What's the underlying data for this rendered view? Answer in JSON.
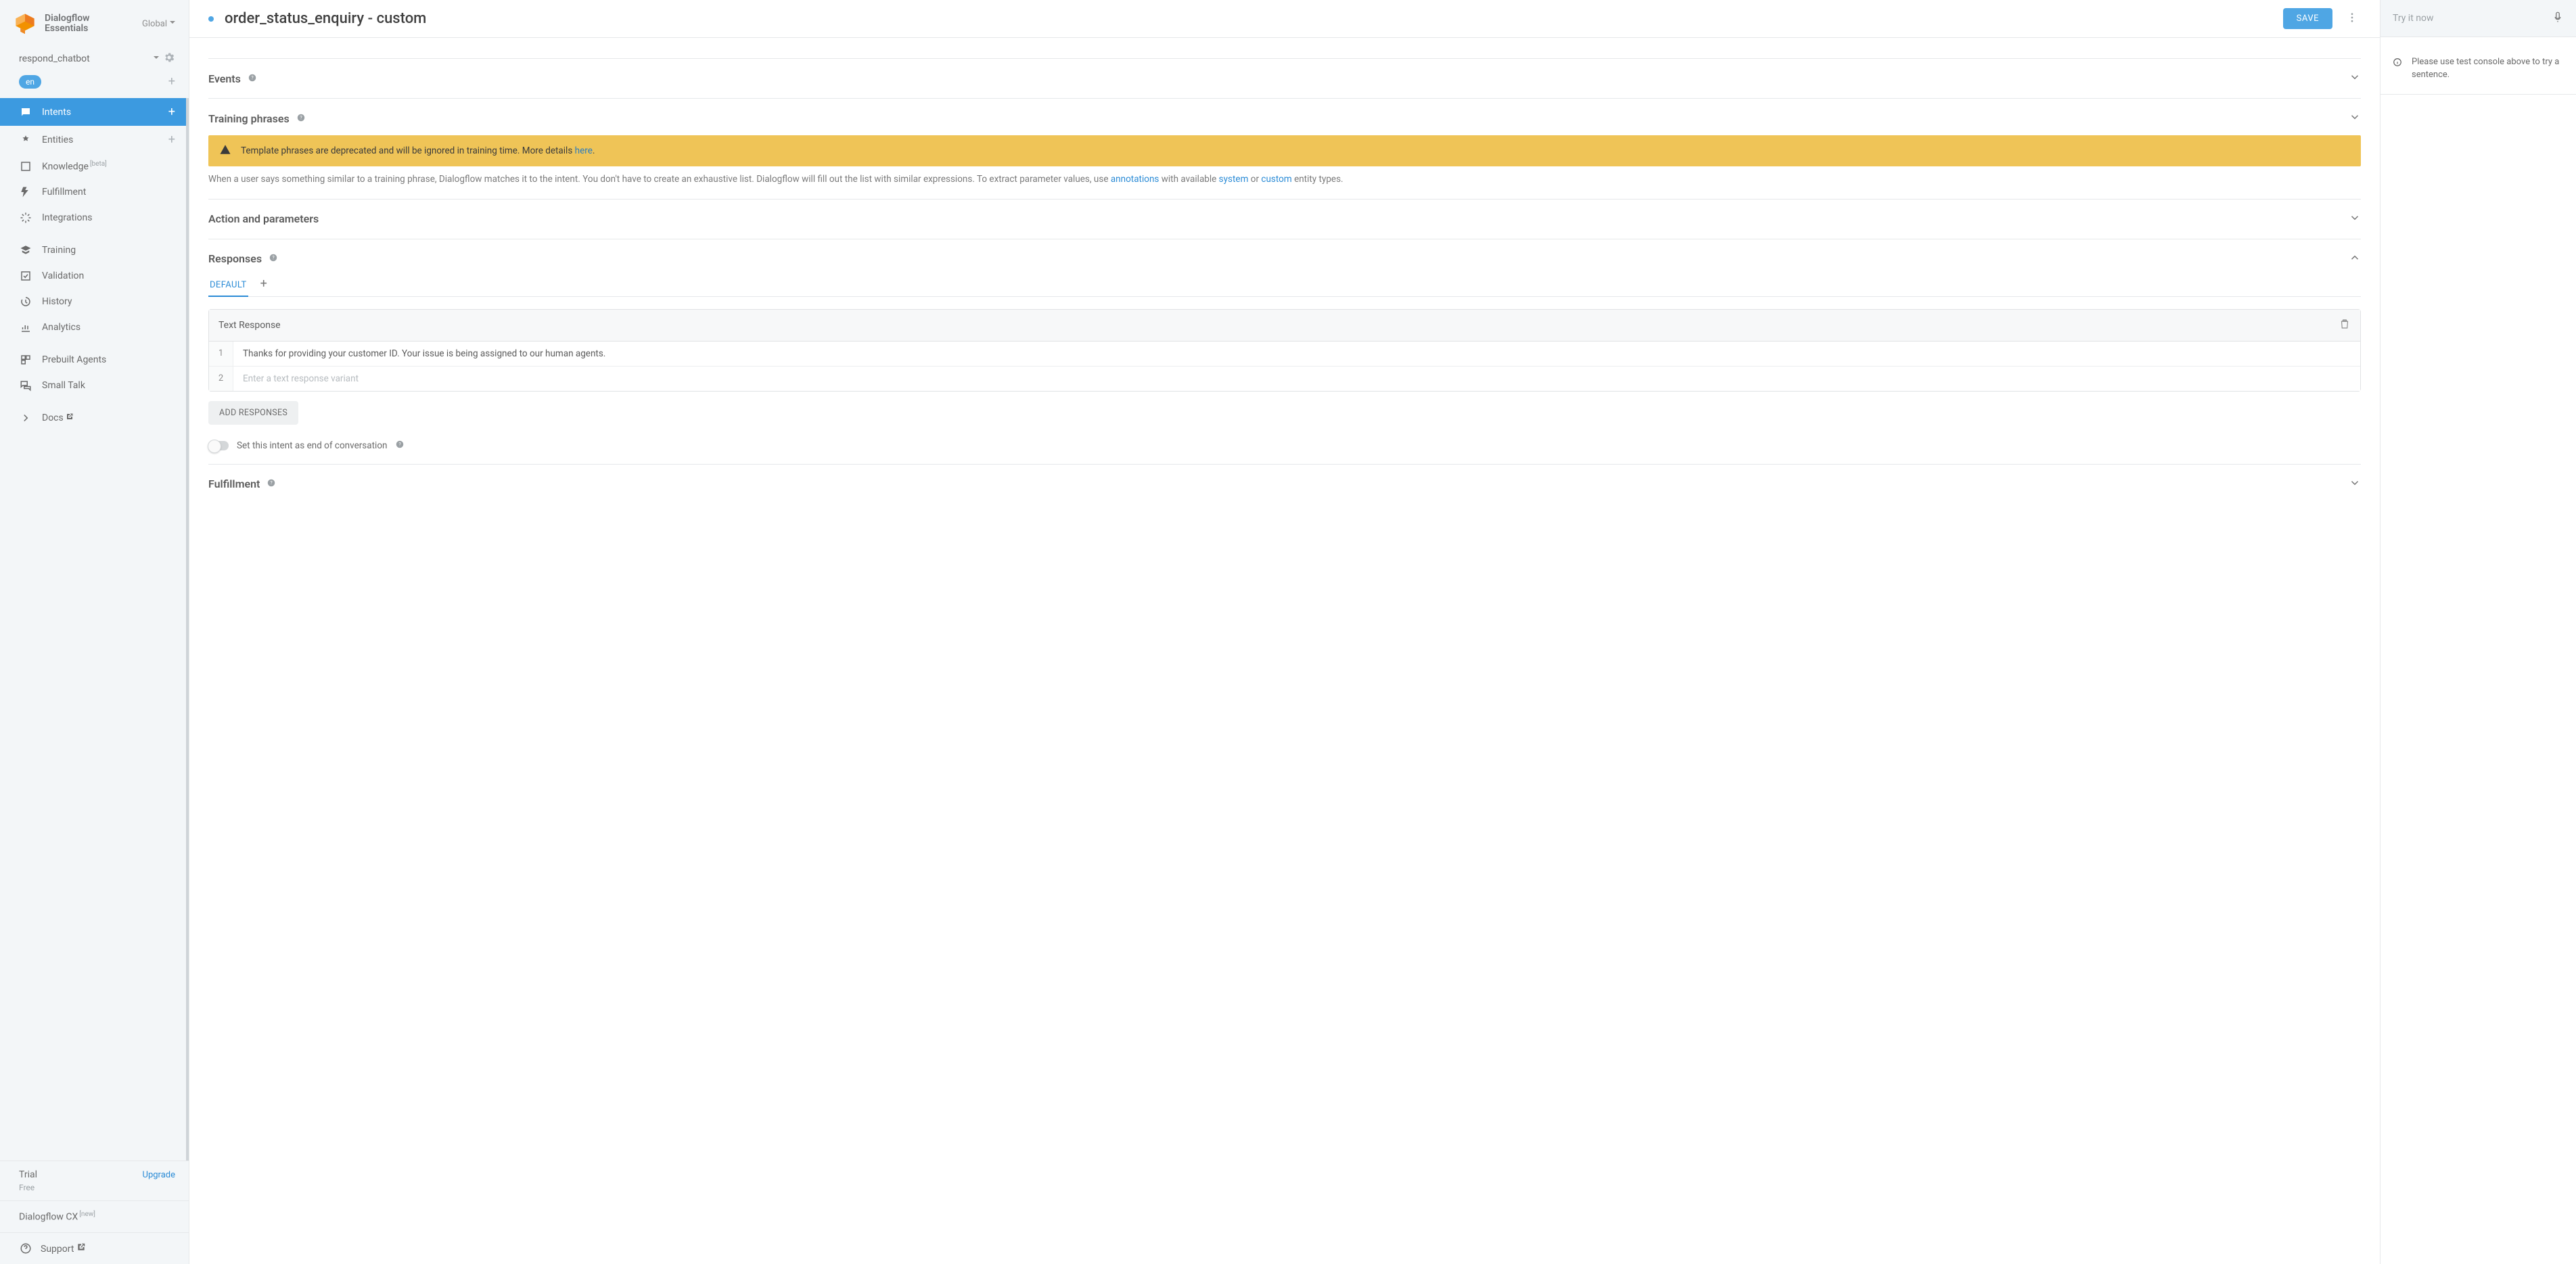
{
  "brand": {
    "name1": "Dialogflow",
    "name2": "Essentials",
    "region": "Global"
  },
  "agent": {
    "name": "respond_chatbot",
    "lang": "en"
  },
  "nav": {
    "intents": "Intents",
    "entities": "Entities",
    "knowledge": "Knowledge",
    "knowledge_sup": "[beta]",
    "fulfillment": "Fulfillment",
    "integrations": "Integrations",
    "training": "Training",
    "validation": "Validation",
    "history": "History",
    "analytics": "Analytics",
    "prebuilt": "Prebuilt Agents",
    "smalltalk": "Small Talk",
    "docs": "Docs"
  },
  "sidebar_footer": {
    "tier_title": "Trial",
    "tier_sub": "Free",
    "upgrade": "Upgrade",
    "cx_label": "Dialogflow CX",
    "cx_sup": "[new]",
    "support": "Support"
  },
  "topbar": {
    "title": "order_status_enquiry - custom",
    "save": "SAVE"
  },
  "sections": {
    "events": "Events",
    "training": "Training phrases",
    "action": "Action and parameters",
    "responses": "Responses",
    "fulfillment": "Fulfillment"
  },
  "training": {
    "banner_pre": "Template phrases are deprecated and will be ignored in training time. More details ",
    "banner_link": "here",
    "desc_p1": "When a user says something similar to a training phrase, Dialogflow matches it to the intent. You don't have to create an exhaustive list. Dialogflow will fill out the list with similar expressions. To extract parameter values, use ",
    "link_annotations": "annotations",
    "desc_p2": " with available ",
    "link_system": "system",
    "desc_p3": " or ",
    "link_custom": "custom",
    "desc_p4": " entity types."
  },
  "responses": {
    "tab_default": "DEFAULT",
    "card_title": "Text Response",
    "rows": {
      "r1_num": "1",
      "r1_val": "Thanks for providing your customer ID. Your issue is being assigned to our human agents.",
      "r2_num": "2",
      "r2_ph": "Enter a text response variant"
    },
    "add_btn": "ADD RESPONSES",
    "end_label": "Set this intent as end of conversation"
  },
  "aside": {
    "try_ph": "Try it now",
    "msg": "Please use test console above to try a sentence."
  }
}
